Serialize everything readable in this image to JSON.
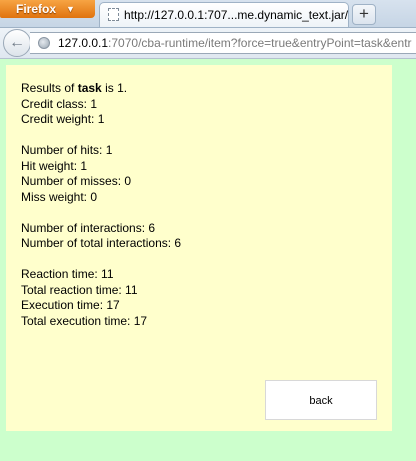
{
  "browser": {
    "menu_button_label": "Firefox",
    "tab_title": "http://127.0.0.1:707...me.dynamic_text.jar/",
    "new_tab_label": "+",
    "url_host": "127.0.0.1",
    "url_rest": ":7070/cba-runtime/item?force=true&entryPoint=task&entr"
  },
  "results": {
    "title_prefix": "Results of ",
    "title_task": "task",
    "title_suffix": " is 1.",
    "credit_class": "Credit class: 1",
    "credit_weight": "Credit weight: 1",
    "hits": "Number of hits: 1",
    "hit_weight": "Hit weight: 1",
    "misses": "Number of misses: 0",
    "miss_weight": "Miss weight: 0",
    "interactions": "Number of interactions: 6",
    "total_interactions": "Number of total interactions: 6",
    "reaction_time": "Reaction time: 11",
    "total_reaction_time": "Total reaction time: 11",
    "execution_time": "Execution time: 17",
    "total_execution_time": "Total execution time: 17"
  },
  "back_label": "back",
  "colors": {
    "page_background": "#ccffcc",
    "panel_background": "#ffffcc",
    "firefox_button": "#e0730f"
  }
}
